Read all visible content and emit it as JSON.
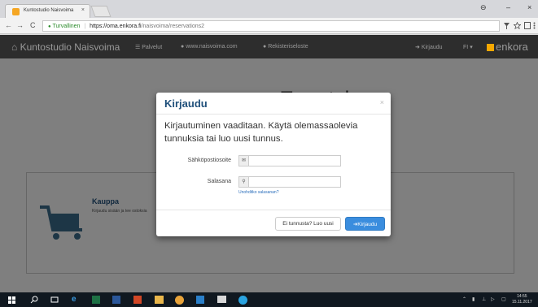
{
  "browser": {
    "tab_title": "Kuntostudio Naisvoima",
    "tab_close": "×",
    "window_controls": {
      "user": "⊖",
      "minimize": "–",
      "close": "×"
    },
    "nav": {
      "back": "←",
      "forward": "→",
      "reload": "C"
    },
    "address": {
      "secure_label": "Turvallinen",
      "host": "https://oma.enkora.fi",
      "path": "/naisvoima/reservations2"
    },
    "toolbar_icons": [
      "funnel-icon",
      "star-icon",
      "extensions-icon",
      "menu-icon"
    ]
  },
  "site": {
    "brand": "Kuntostudio Naisvoima",
    "nav": {
      "services": "Palvelut",
      "website": "www.naisvoima.com",
      "registry": "Rekisteriseloste",
      "login": "Kirjaudu",
      "lang": "FI"
    },
    "logo": "enkora",
    "page_title": "Tervetuloa",
    "shop": {
      "title": "Kauppa",
      "description": "Kirjaudu sisään ja tee ostoksia"
    }
  },
  "modal": {
    "title": "Kirjaudu",
    "close": "×",
    "intro": "Kirjautuminen vaaditaan. Käytä olemassaolevia tunnuksia tai luo uusi tunnus.",
    "email_label": "Sähköpostiosoite",
    "email_value": "",
    "password_label": "Salasana",
    "password_value": "",
    "forgot": "Unohditko salasanan?",
    "register_button": "Ei tunnusta? Luo uusi",
    "login_button": "Kirjaudu"
  },
  "taskbar": {
    "clock_time": "14:55",
    "clock_date": "15.11.2017"
  },
  "colors": {
    "navbar": "#2d2d2d",
    "title_blue": "#1f4f7a",
    "primary": "#3a8dde",
    "enkora_orange": "#f7a800",
    "link": "#2a6ebb"
  }
}
